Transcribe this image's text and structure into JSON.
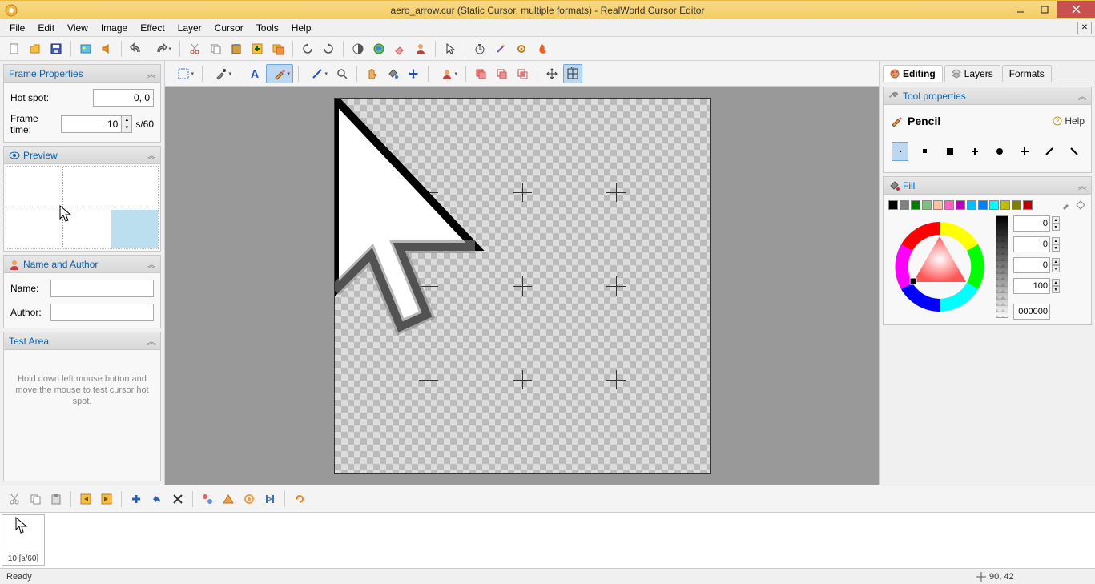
{
  "title": "aero_arrow.cur (Static Cursor, multiple formats) - RealWorld Cursor Editor",
  "menu": [
    "File",
    "Edit",
    "View",
    "Image",
    "Effect",
    "Layer",
    "Cursor",
    "Tools",
    "Help"
  ],
  "left": {
    "frame_props_title": "Frame Properties",
    "hotspot_label": "Hot spot:",
    "hotspot_value": "0, 0",
    "frametime_label": "Frame time:",
    "frametime_value": "10",
    "frametime_unit": "s/60",
    "preview_title": "Preview",
    "nameauthor_title": "Name and Author",
    "name_label": "Name:",
    "name_value": "",
    "author_label": "Author:",
    "author_value": "",
    "testarea_title": "Test Area",
    "testarea_hint": "Hold down left mouse button and move the mouse to test cursor hot spot."
  },
  "right": {
    "tabs": [
      "Editing",
      "Layers",
      "Formats"
    ],
    "toolprops_title": "Tool properties",
    "tool_name": "Pencil",
    "help_label": "Help",
    "fill_title": "Fill",
    "r": "0",
    "g": "0",
    "b": "0",
    "a": "100",
    "hex": "000000",
    "swatches": [
      "#000000",
      "#808080",
      "#008000",
      "#7fbf7f",
      "#ffc0a0",
      "#ff60c0",
      "#c000c0",
      "#00c0ff",
      "#0080ff",
      "#00ffff",
      "#c0c000",
      "#808000",
      "#c00000"
    ]
  },
  "frame": {
    "label": "10 [s/60]"
  },
  "status": {
    "ready": "Ready",
    "coords": "90, 42"
  }
}
